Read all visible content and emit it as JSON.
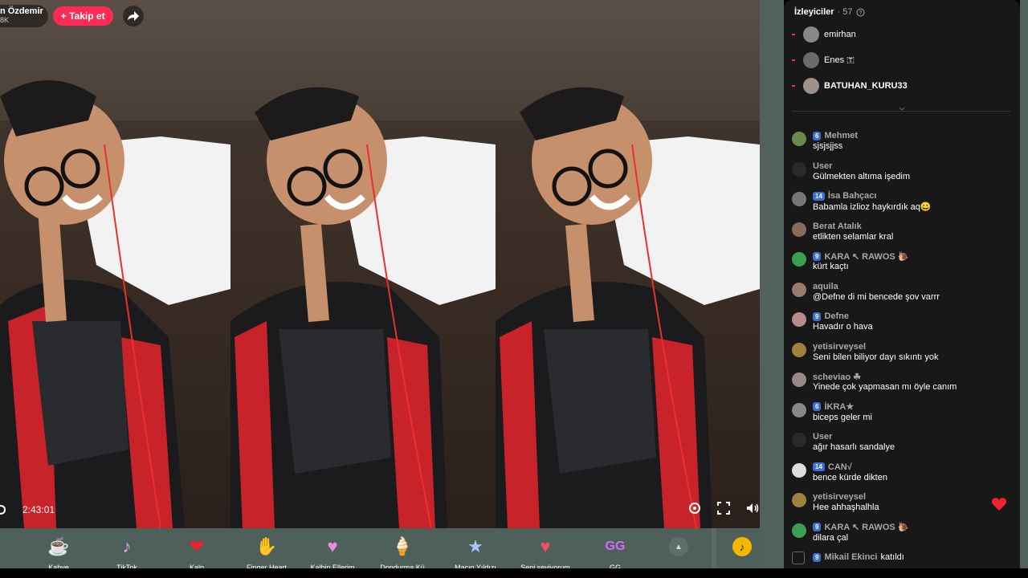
{
  "host": {
    "name": "n Özdemir",
    "followers": "8K",
    "follow_label": "+ Takip et"
  },
  "player": {
    "elapsed": "2:43:01"
  },
  "gifts": [
    {
      "label": "Kahve",
      "icon": "coffee-icon",
      "glyph": "☕"
    },
    {
      "label": "TikTok",
      "icon": "tiktok-icon",
      "glyph": "♪"
    },
    {
      "label": "Kalp",
      "icon": "heart-icon",
      "glyph": "❤"
    },
    {
      "label": "Finger Heart",
      "icon": "finger-heart-icon",
      "glyph": "✋"
    },
    {
      "label": "Kalbin Ellerim",
      "icon": "heart-hands-icon",
      "glyph": "♥"
    },
    {
      "label": "Dondurma Kü",
      "icon": "ice-cream-icon",
      "glyph": "🍦"
    },
    {
      "label": "Maçın Yıldızı",
      "icon": "star-icon",
      "glyph": "★"
    },
    {
      "label": "Seni seviyorum",
      "icon": "love-icon",
      "glyph": "♥"
    },
    {
      "label": "GG",
      "icon": "gg-icon",
      "glyph": "GG"
    }
  ],
  "viewers": {
    "title": "İzleyiciler",
    "count": "· 57",
    "list": [
      {
        "name": "emirhan"
      },
      {
        "name": "Enes 🇹"
      },
      {
        "name": "BATUHAN_KURU33"
      }
    ]
  },
  "chat": [
    {
      "level": "6",
      "user": "Mehmet",
      "text": "sjsjsjjss",
      "avatar_color": "#6a8a4a"
    },
    {
      "level": "",
      "user": "User",
      "text": "Gülmekten altıma işedim",
      "avatar_color": "#2a2a2a"
    },
    {
      "level": "14",
      "user": "İsa Bahçacı",
      "text": "Babamla izlioz haykırdık aq😀",
      "avatar_color": "#777"
    },
    {
      "level": "",
      "user": "Berat Atalık",
      "text": "etlikten selamlar kral",
      "avatar_color": "#8a6a5a"
    },
    {
      "level": "9",
      "user": "KARA ↖ RAWOS 🐌",
      "text": "kürt kaçtı",
      "avatar_color": "#3aa050"
    },
    {
      "level": "",
      "user": "aquila",
      "text": "@Defne di mi bencede şov varrr",
      "avatar_color": "#9a7a6a"
    },
    {
      "level": "9",
      "user": "Defne",
      "text": "Havadır o hava",
      "avatar_color": "#b88a8a"
    },
    {
      "level": "",
      "user": "yetisirveysel",
      "text": "Seni bilen biliyor dayı sıkıntı yok",
      "avatar_color": "#a08040"
    },
    {
      "level": "",
      "user": "scheviao ☘",
      "text": "Yinede çok yapmasan mı öyle canım",
      "avatar_color": "#998888"
    },
    {
      "level": "6",
      "user": "İKRA★",
      "text": "biceps geler mi",
      "avatar_color": "#888"
    },
    {
      "level": "",
      "user": "User",
      "text": "ağır hasarlı sandalye",
      "avatar_color": "#2a2a2a"
    },
    {
      "level": "14",
      "user": "CAN√",
      "text": "bence kürde dikten",
      "avatar_color": "#ddd"
    },
    {
      "level": "",
      "user": "yetisirveysel",
      "text": "Hee ahhaşhalhla",
      "avatar_color": "#a08040"
    },
    {
      "level": "9",
      "user": "KARA ↖ RAWOS 🐌",
      "text": "dilara çal",
      "avatar_color": "#3aa050"
    }
  ],
  "joined": {
    "level": "9",
    "user": "Mikail Ekinci",
    "text": "katıldı"
  },
  "colors": {
    "accent": "#fe2c55",
    "level_badge": "#3b6fd8",
    "chat_bg": "#181818",
    "gift_bar": "#4f5f5a"
  }
}
